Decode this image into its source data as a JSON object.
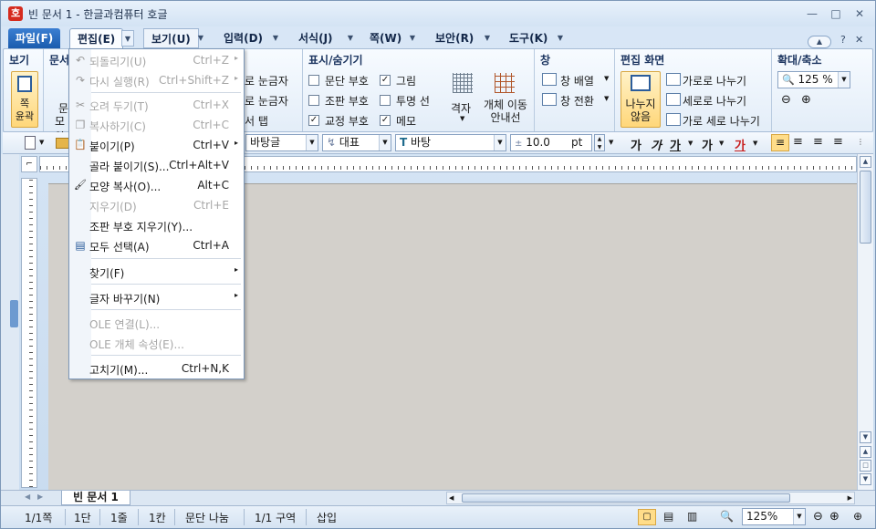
{
  "window": {
    "title": "빈 문서 1 - 한글과컴퓨터 호글",
    "app_icon": "호",
    "minimize": "—",
    "restore": "□",
    "close": "✕"
  },
  "menu_tabs": [
    "파일(F)",
    "편집(E)",
    "보기(U)",
    "입력(D)",
    "서식(J)",
    "쪽(W)",
    "보안(R)",
    "도구(K)"
  ],
  "menu_right": {
    "help": "?",
    "close": "✕"
  },
  "ribbon": {
    "view_group": {
      "label": "보기",
      "button": "쪽\n윤곽"
    },
    "partial_group": {
      "label": "문서",
      "items": [
        "문",
        "모양"
      ]
    },
    "ruler_items": [
      "로 눈금자",
      "로 눈금자",
      "서 탭"
    ],
    "show_hide": {
      "label": "표시/숨기기",
      "checks": [
        {
          "label": "문단 부호",
          "checked": false
        },
        {
          "label": "그림",
          "checked": true
        },
        {
          "label": "조판 부호",
          "checked": false
        },
        {
          "label": "투명 선",
          "checked": false
        },
        {
          "label": "교정 부호",
          "checked": true
        },
        {
          "label": "메모",
          "checked": true
        }
      ],
      "grid": "격자",
      "move_guide": "개체 이동\n안내선"
    },
    "window_group": {
      "label": "창",
      "arrange": "창 배열",
      "switch": "창 전환"
    },
    "edit_screen": {
      "label": "편집 화면",
      "no_split": "나누지\n않음",
      "split_h": "가로로 나누기",
      "split_v": "세로로 나누기",
      "split_both": "가로 세로 나누기"
    },
    "zoom_group": {
      "label": "확대/축소",
      "zoom": "125 %"
    }
  },
  "toolbar": {
    "style": "바탕글",
    "lang": "대표",
    "font": "바탕",
    "size": "10.0",
    "unit": "pt",
    "fmt": [
      "가",
      "가",
      "가",
      "가",
      "가"
    ]
  },
  "dropdown": [
    {
      "icon": "undo-icon",
      "glyph": "↶",
      "label": "되돌리기(U)",
      "shortcut": "Ctrl+Z",
      "arrow": "▸",
      "disabled": true
    },
    {
      "icon": "redo-icon",
      "glyph": "↷",
      "label": "다시 실행(R)",
      "shortcut": "Ctrl+Shift+Z",
      "arrow": "▸",
      "disabled": true
    },
    {
      "icon": "cut-icon",
      "glyph": "✂",
      "label": "오려 두기(T)",
      "shortcut": "Ctrl+X",
      "disabled": true
    },
    {
      "icon": "copy-icon",
      "glyph": "❐",
      "label": "복사하기(C)",
      "shortcut": "Ctrl+C",
      "disabled": true
    },
    {
      "icon": "paste-icon",
      "glyph": "📋",
      "label": "붙이기(P)",
      "shortcut": "Ctrl+V",
      "arrow": "▸",
      "disabled": false
    },
    {
      "icon": "",
      "glyph": "",
      "label": "골라 붙이기(S)...",
      "shortcut": "Ctrl+Alt+V",
      "disabled": false
    },
    {
      "icon": "format-painter-icon",
      "glyph": "🖌",
      "label": "모양 복사(O)...",
      "shortcut": "Alt+C",
      "disabled": false
    },
    {
      "icon": "",
      "glyph": "",
      "label": "지우기(D)",
      "shortcut": "Ctrl+E",
      "disabled": true
    },
    {
      "icon": "",
      "glyph": "",
      "label": "조판 부호 지우기(Y)...",
      "shortcut": "",
      "disabled": false
    },
    {
      "icon": "select-all-icon",
      "glyph": "▤",
      "label": "모두 선택(A)",
      "shortcut": "Ctrl+A",
      "disabled": false
    },
    {
      "icon": "",
      "glyph": "",
      "label": "찾기(F)",
      "shortcut": "",
      "arrow": "▸",
      "disabled": false
    },
    {
      "icon": "",
      "glyph": "",
      "label": "글자 바꾸기(N)",
      "shortcut": "",
      "arrow": "▸",
      "disabled": false
    },
    {
      "icon": "",
      "glyph": "",
      "label": "OLE 연결(L)...",
      "shortcut": "",
      "disabled": true
    },
    {
      "icon": "",
      "glyph": "",
      "label": "OLE 개체 속성(E)...",
      "shortcut": "",
      "disabled": true
    },
    {
      "icon": "",
      "glyph": "",
      "label": "고치기(M)...",
      "shortcut": "Ctrl+N,K",
      "disabled": false
    }
  ],
  "doc_tab": "빈 문서 1",
  "status": {
    "page": "1/1쪽",
    "section": "1단",
    "line": "1줄",
    "col": "1칸",
    "split": "문단 나눔",
    "region": "1/1 구역",
    "mode": "삽입",
    "zoom": "125%"
  },
  "colors": {
    "accent": "#1b5cae",
    "fmt_red": "#c81e1e"
  }
}
